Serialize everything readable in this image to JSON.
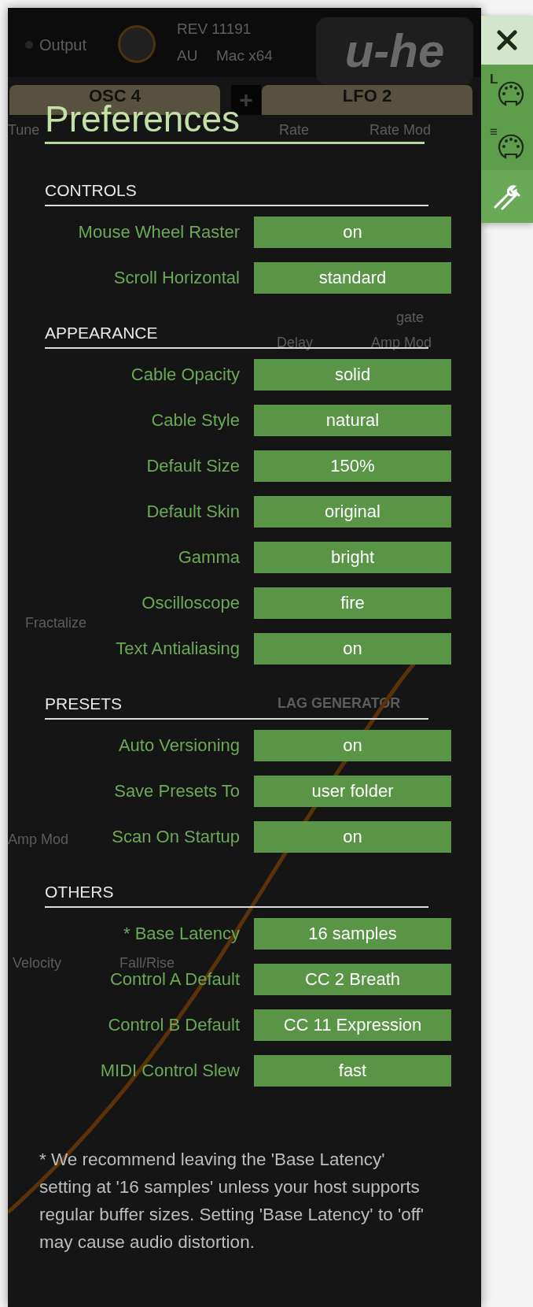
{
  "background": {
    "output_label": "Output",
    "revision": "REV 11191",
    "format": "AU",
    "platform": "Mac x64",
    "logo": "u-he",
    "add_button": "+",
    "module_tabs": [
      "OSC 4",
      "LFO 2"
    ],
    "labels": [
      "Tune",
      "Rate",
      "Rate Mod",
      "gate",
      "Delay",
      "Amp Mod",
      "Fractalize",
      "LAG GENERATOR",
      "Amp Mod",
      "Velocity",
      "Fall/Rise"
    ]
  },
  "side_tabs": [
    {
      "kind": "midi",
      "badge": "L",
      "selected": false
    },
    {
      "kind": "midi",
      "badge": "≡",
      "selected": false
    },
    {
      "kind": "tools",
      "selected": true
    }
  ],
  "preferences": {
    "title": "Preferences",
    "sections": [
      {
        "title": "CONTROLS",
        "settings": [
          {
            "label": "Mouse Wheel Raster",
            "value": "on"
          },
          {
            "label": "Scroll Horizontal",
            "value": "standard"
          }
        ]
      },
      {
        "title": "APPEARANCE",
        "settings": [
          {
            "label": "Cable Opacity",
            "value": "solid"
          },
          {
            "label": "Cable Style",
            "value": "natural"
          },
          {
            "label": "Default Size",
            "value": "150%"
          },
          {
            "label": "Default Skin",
            "value": "original"
          },
          {
            "label": "Gamma",
            "value": "bright"
          },
          {
            "label": "Oscilloscope",
            "value": "fire"
          },
          {
            "label": "Text Antialiasing",
            "value": "on"
          }
        ]
      },
      {
        "title": "PRESETS",
        "settings": [
          {
            "label": "Auto Versioning",
            "value": "on"
          },
          {
            "label": "Save Presets To",
            "value": "user folder"
          },
          {
            "label": "Scan On Startup",
            "value": "on"
          }
        ]
      },
      {
        "title": "OTHERS",
        "settings": [
          {
            "label": "* Base Latency",
            "value": "16 samples"
          },
          {
            "label": "Control A Default",
            "value": "CC 2 Breath"
          },
          {
            "label": "Control B Default",
            "value": "CC 11 Expression"
          },
          {
            "label": "MIDI Control Slew",
            "value": "fast"
          }
        ]
      }
    ],
    "footnote": "* We recommend leaving the 'Base Latency' setting at '16 samples' unless your host supports regular buffer sizes. Setting 'Base Latency' to 'off' may cause audio distortion."
  }
}
